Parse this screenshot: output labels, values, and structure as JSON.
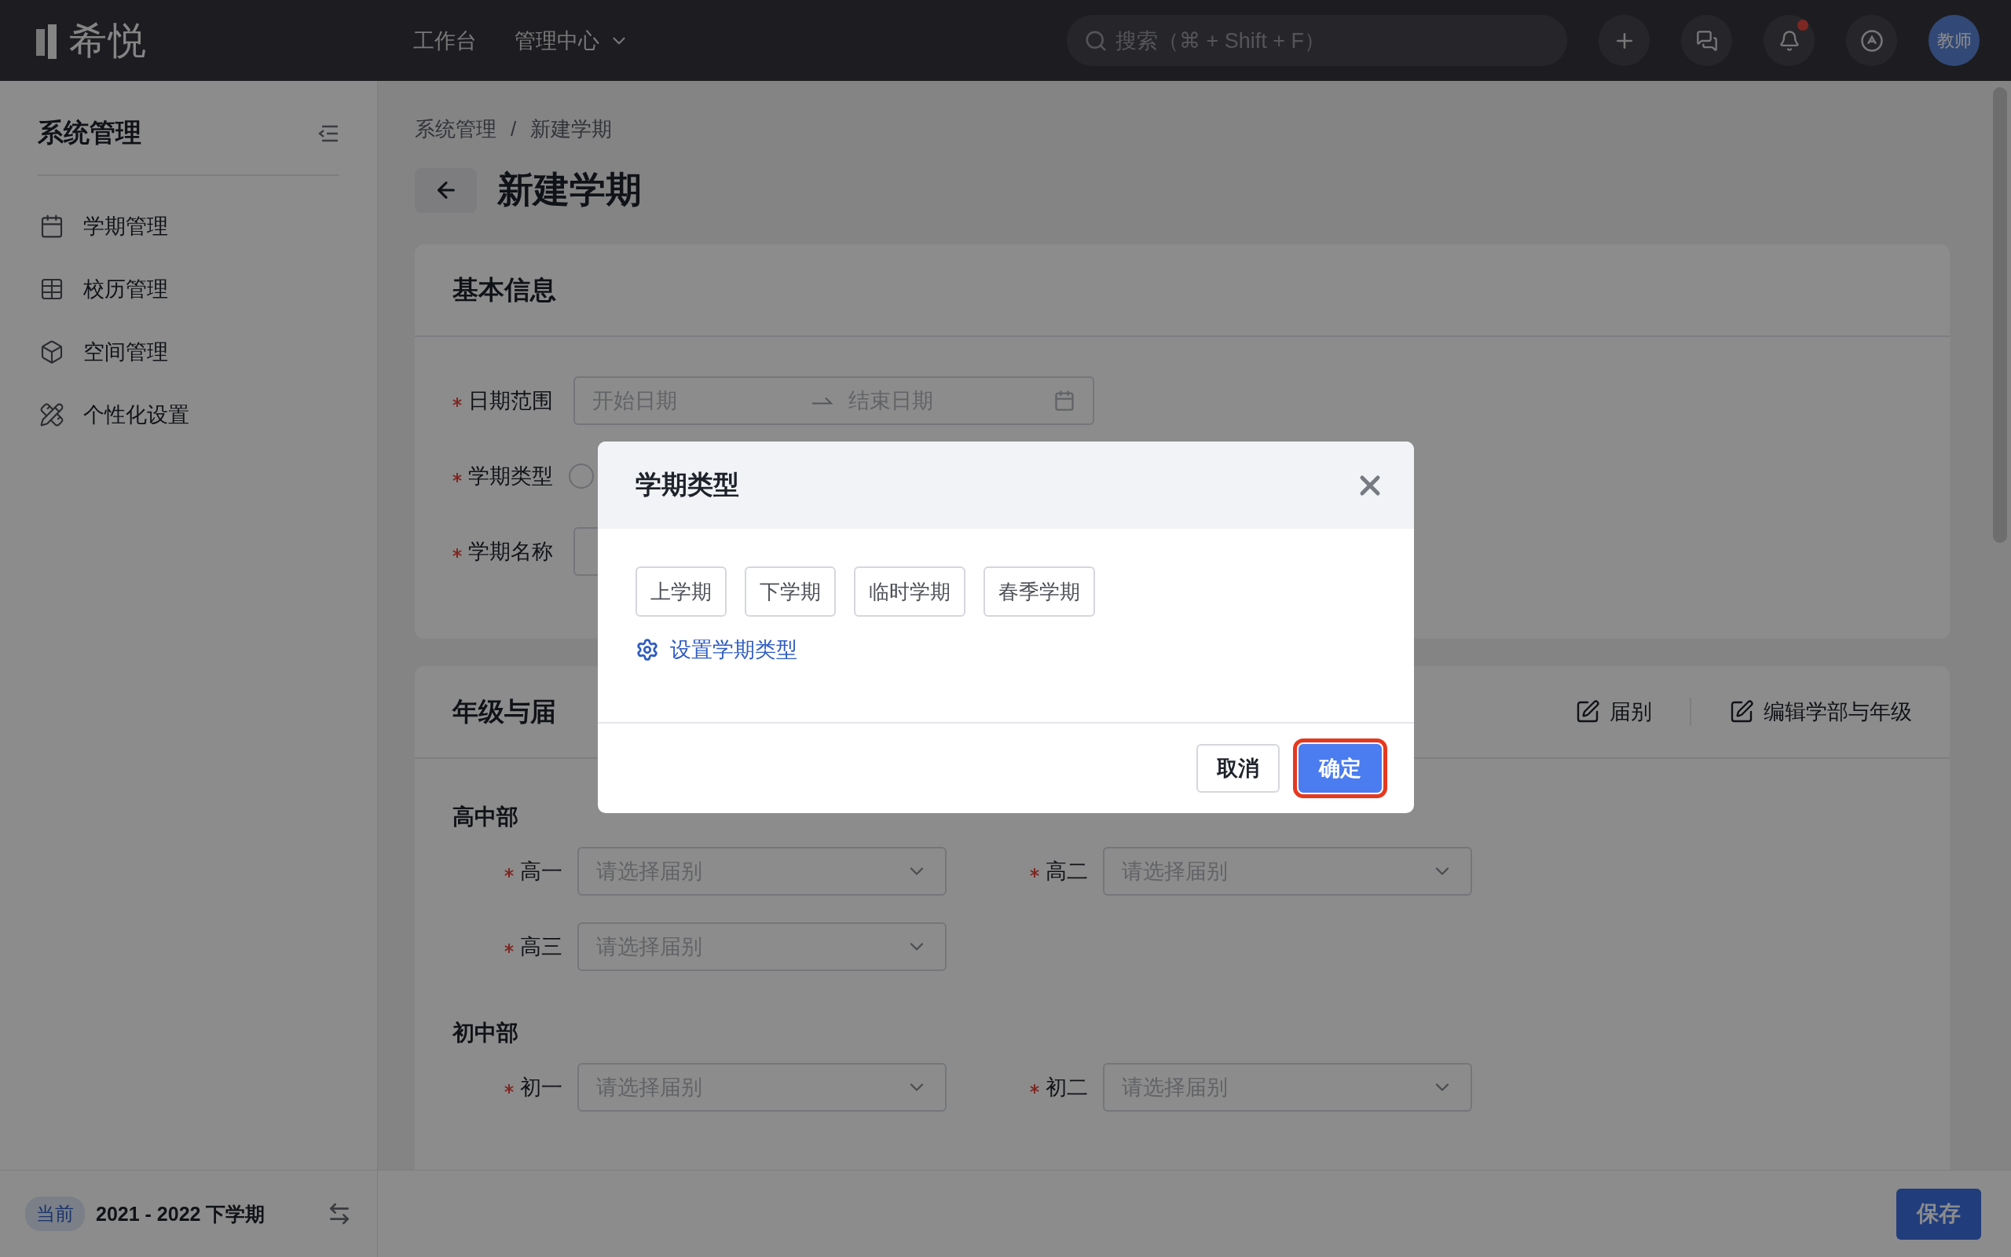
{
  "header": {
    "logo": "希悦",
    "nav": [
      {
        "label": "工作台",
        "dropdown": false
      },
      {
        "label": "管理中心",
        "dropdown": true
      }
    ],
    "search": {
      "placeholder": "搜索（⌘ + Shift + F）"
    },
    "notifications": {
      "unread": true
    },
    "avatar": "教师"
  },
  "sidebar": {
    "title": "系统管理",
    "items": [
      {
        "label": "学期管理",
        "kind": "calendar"
      },
      {
        "label": "校历管理",
        "kind": "table"
      },
      {
        "label": "空间管理",
        "kind": "cube"
      },
      {
        "label": "个性化设置",
        "kind": "tools"
      }
    ],
    "footer": {
      "badge": "当前",
      "term": "2021 - 2022 下学期"
    }
  },
  "breadcrumb": {
    "items": [
      "系统管理",
      "新建学期"
    ],
    "separator": "/"
  },
  "page_title": "新建学期",
  "basic_info": {
    "title": "基本信息",
    "fields": [
      {
        "kind": "date_range",
        "label": "日期范围",
        "required": true,
        "start_placeholder": "开始日期",
        "end_placeholder": "结束日期"
      },
      {
        "kind": "radio",
        "label": "学期类型",
        "required": true,
        "checked": false
      },
      {
        "kind": "text",
        "label": "学期名称",
        "required": true
      }
    ]
  },
  "grades": {
    "title": "年级与届",
    "actions": [
      "届别",
      "编辑学部与年级"
    ],
    "sections": [
      {
        "title": "高中部",
        "fields": [
          {
            "label": "高一",
            "required": true,
            "placeholder": "请选择届别"
          },
          {
            "label": "高二",
            "required": true,
            "placeholder": "请选择届别"
          },
          {
            "label": "高三",
            "required": true,
            "placeholder": "请选择届别"
          }
        ]
      },
      {
        "title": "初中部",
        "fields": [
          {
            "label": "初一",
            "required": true,
            "placeholder": "请选择届别"
          },
          {
            "label": "初二",
            "required": true,
            "placeholder": "请选择届别"
          }
        ]
      }
    ]
  },
  "save_button": "保存",
  "modal": {
    "title": "学期类型",
    "options": [
      {
        "label": "上学期",
        "selected": false
      },
      {
        "label": "下学期",
        "selected": false
      },
      {
        "label": "临时学期",
        "selected": false
      },
      {
        "label": "春季学期",
        "selected": false
      }
    ],
    "settings_link": "设置学期类型",
    "buttons": [
      {
        "label": "取消",
        "kind": "default",
        "highlighted": false
      },
      {
        "label": "确定",
        "kind": "primary",
        "highlighted": true
      }
    ]
  }
}
